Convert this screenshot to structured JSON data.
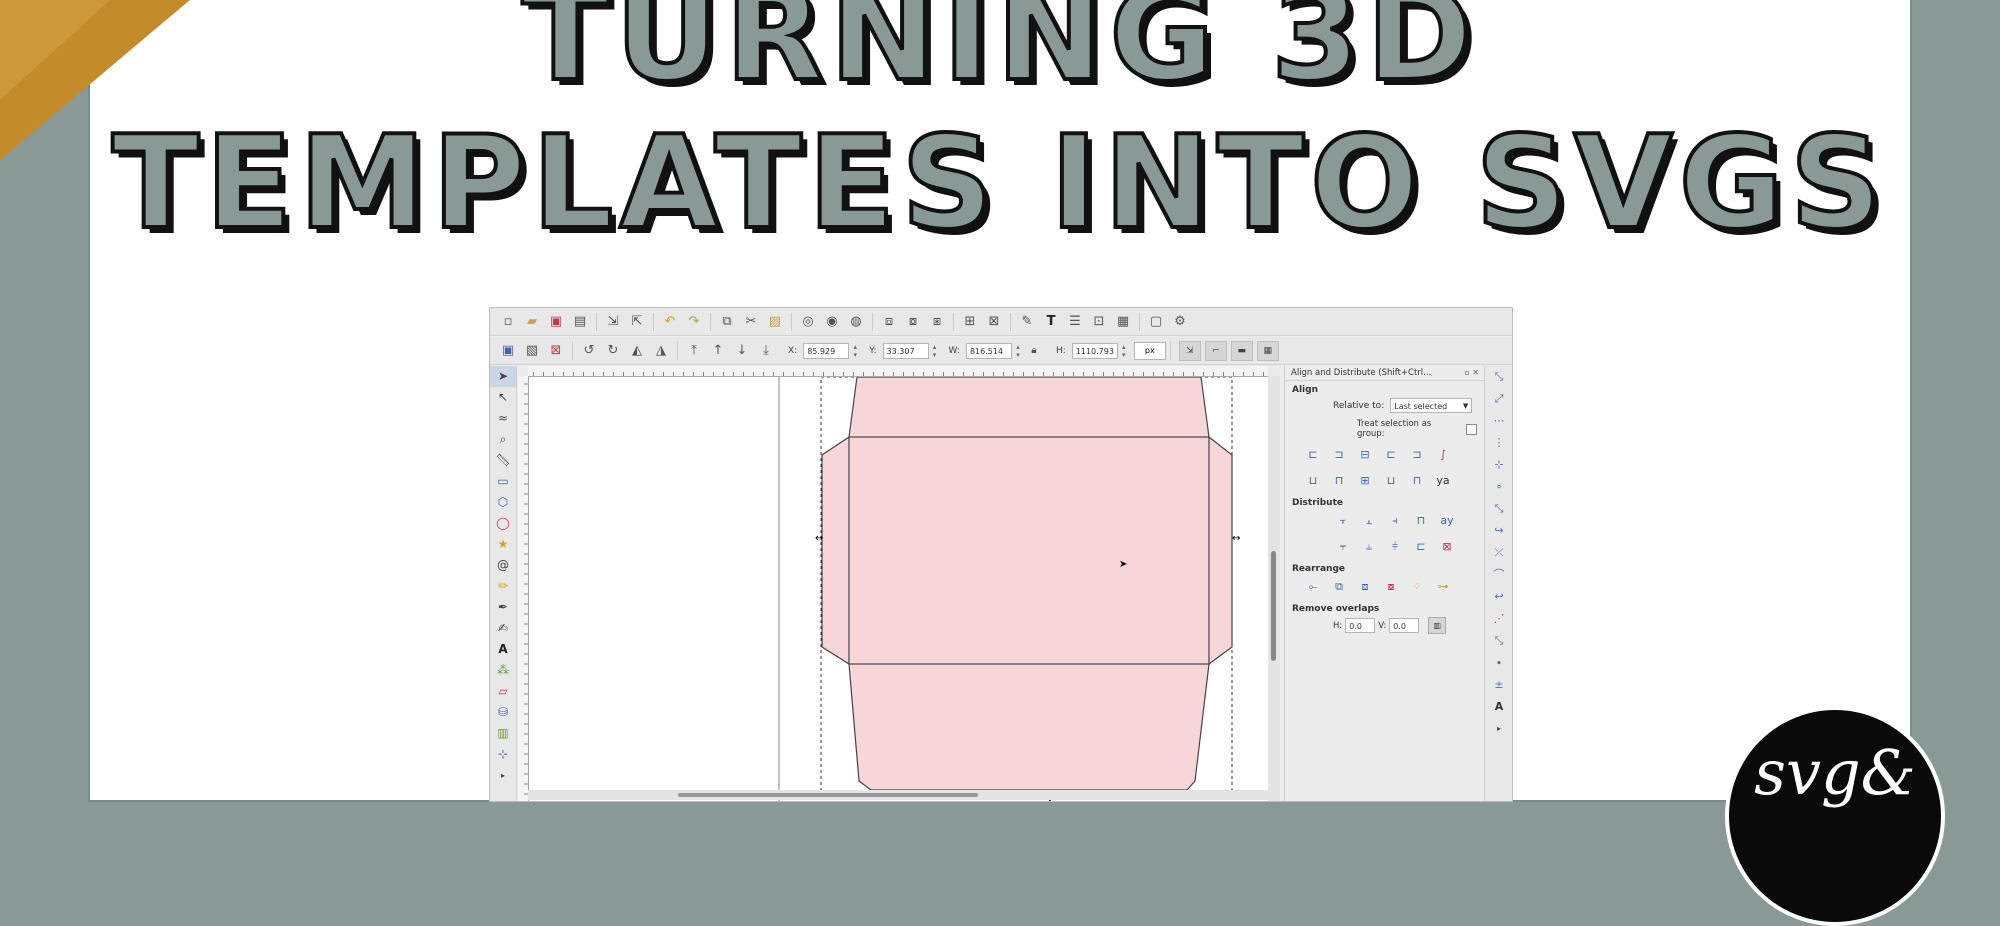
{
  "title": {
    "line1": "TURNING 3D",
    "line2": "TEMPLATES INTO SVGS"
  },
  "colors": {
    "background": "#899a96",
    "title_fill": "#899a96",
    "title_outline": "#111111",
    "envelope_fill": "#f7d6da",
    "gold": "#c48b2a"
  },
  "app": {
    "toolbar1_icons": [
      "new-doc-icon",
      "open-icon",
      "save-icon",
      "print-icon",
      "import-icon",
      "export-icon",
      "undo-icon",
      "redo-icon",
      "duplicate-icon",
      "cut-icon",
      "paste-icon",
      "zoom-selection-icon",
      "zoom-drawing-icon",
      "zoom-page-icon",
      "group-icon",
      "ungroup-icon",
      "clone-icon",
      "align-icon",
      "transform-icon",
      "fill-stroke-icon",
      "text-icon",
      "layers-icon",
      "xml-icon",
      "objects-icon",
      "preferences-icon",
      "document-props-icon"
    ],
    "controls": {
      "x": {
        "label": "X:",
        "value": "85.929"
      },
      "y": {
        "label": "Y:",
        "value": "33.307"
      },
      "w": {
        "label": "W:",
        "value": "816.514"
      },
      "h": {
        "label": "H:",
        "value": "1110.793"
      },
      "unit": "px"
    },
    "tools": [
      "selector-icon",
      "node-icon",
      "tweak-icon",
      "zoom-icon",
      "measure-icon",
      "rect-icon",
      "3dbox-icon",
      "ellipse-icon",
      "star-icon",
      "spiral-icon",
      "pencil-icon",
      "pen-icon",
      "calligraphy-icon",
      "text-tool-icon",
      "spray-icon",
      "eraser-icon",
      "bucket-icon",
      "gradient-icon",
      "dropper-icon"
    ],
    "align_panel": {
      "title": "Align and Distribute (Shift+Ctrl...",
      "align_heading": "Align",
      "relative_label": "Relative to:",
      "relative_value": "Last selected",
      "treat_label": "Treat selection as group:",
      "distribute_heading": "Distribute",
      "rearrange_heading": "Rearrange",
      "overlap_heading": "Remove overlaps",
      "h_label": "H:",
      "h_value": "0.0",
      "v_label": "V:",
      "v_value": "0.0"
    }
  },
  "logo": {
    "text": "svg&"
  }
}
